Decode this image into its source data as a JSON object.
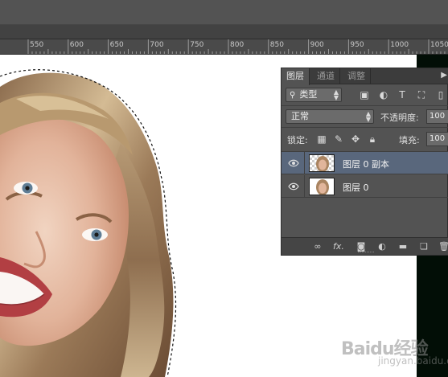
{
  "ruler": {
    "labels": [
      "550",
      "600",
      "650",
      "700",
      "750",
      "800",
      "850",
      "900",
      "950",
      "1000",
      "1050"
    ]
  },
  "layers_panel": {
    "tabs": [
      {
        "label": "图层",
        "active": true
      },
      {
        "label": "通道",
        "active": false
      },
      {
        "label": "调整",
        "active": false
      }
    ],
    "menu_icon": "panel-menu-icon",
    "filter": {
      "kind_label": "类型"
    },
    "blend_mode": "正常",
    "opacity_label": "不透明度:",
    "opacity_value": "100",
    "lock_label": "锁定:",
    "fill_label": "填充:",
    "fill_value": "100",
    "layers": [
      {
        "name": "图层 0 副本",
        "selected": true,
        "visible": true
      },
      {
        "name": "图层 0",
        "selected": false,
        "visible": true
      }
    ]
  },
  "watermark": {
    "text": "Baidu经验",
    "sub": "jingyan.baidu.com"
  },
  "colors": {
    "panel_bg": "#535353",
    "selected_layer": "#59677c",
    "ruler_bg": "#4a4a4a"
  }
}
